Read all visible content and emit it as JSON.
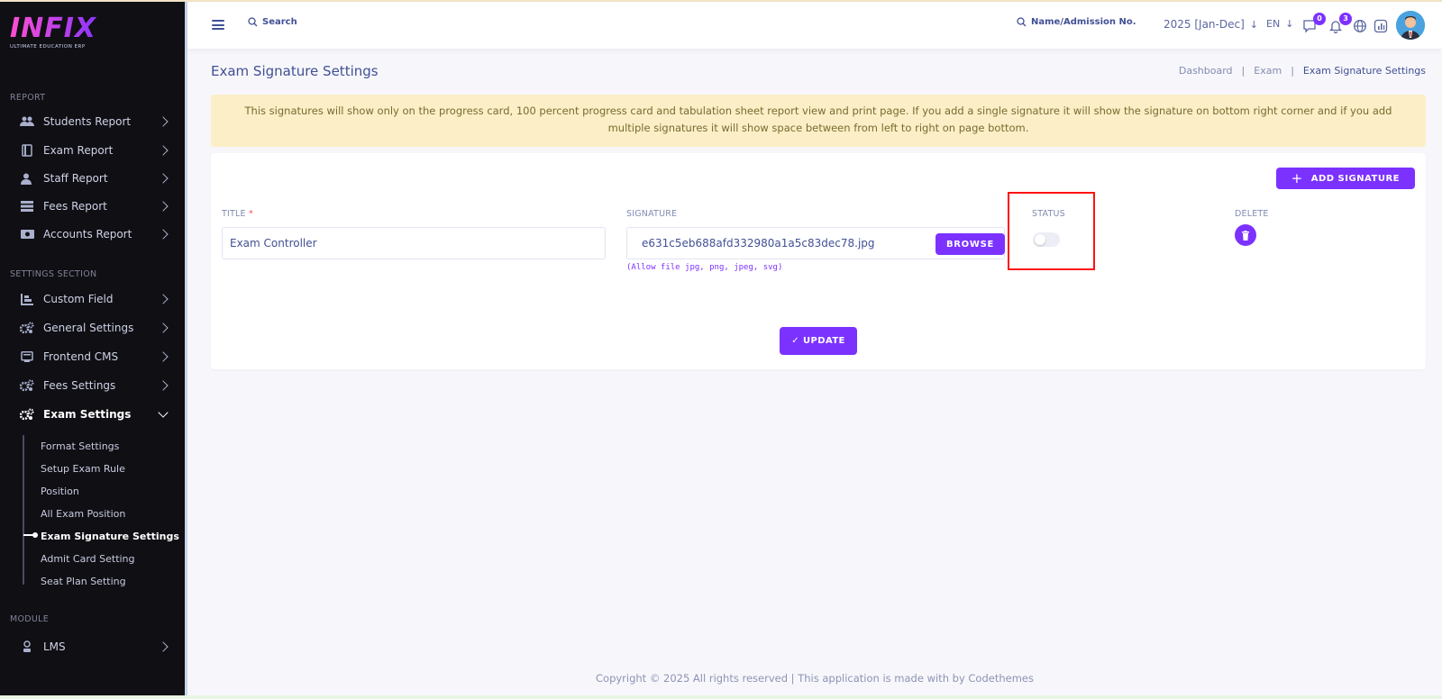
{
  "brand": {
    "logo": "INFIX",
    "tagline": "ULTIMATE EDUCATION ERP"
  },
  "sidebar": {
    "sections": {
      "report": "REPORT",
      "settings": "SETTINGS SECTION",
      "module": "MODULE"
    },
    "report_items": [
      {
        "label": "Students Report",
        "icon": "students-icon"
      },
      {
        "label": "Exam Report",
        "icon": "exam-report-icon"
      },
      {
        "label": "Staff Report",
        "icon": "staff-icon"
      },
      {
        "label": "Fees Report",
        "icon": "fees-report-icon"
      },
      {
        "label": "Accounts Report",
        "icon": "money-icon"
      }
    ],
    "settings_items": [
      {
        "label": "Custom Field",
        "icon": "custom-field-icon"
      },
      {
        "label": "General Settings",
        "icon": "gears-icon"
      },
      {
        "label": "Frontend CMS",
        "icon": "cms-icon"
      },
      {
        "label": "Fees Settings",
        "icon": "gears-icon"
      },
      {
        "label": "Exam Settings",
        "icon": "gears-icon"
      }
    ],
    "exam_settings_sub": [
      "Format Settings",
      "Setup Exam Rule",
      "Position",
      "All Exam Position",
      "Exam Signature Settings",
      "Admit Card Setting",
      "Seat Plan Setting"
    ],
    "module_items": [
      {
        "label": "LMS",
        "icon": "lms-icon"
      }
    ]
  },
  "header": {
    "search_placeholder": "Search",
    "student_search_placeholder": "Name/Admission No.",
    "session": "2025 [Jan-Dec]",
    "language": "EN",
    "messages_count": "0",
    "notifications_count": "3"
  },
  "page": {
    "title": "Exam Signature Settings",
    "breadcrumb": [
      "Dashboard",
      "Exam",
      "Exam Signature Settings"
    ],
    "separator": "|",
    "alert": "This signatures will show only on the progress card, 100 percent progress card and tabulation sheet report view and print page. If you add a single signature it will show the signature on bottom right corner and if you add multiple signatures it will show space between from left to right on page bottom.",
    "add_button": "ADD SIGNATURE",
    "columns": {
      "title": "TITLE",
      "required_mark": "*",
      "signature": "SIGNATURE",
      "status": "STATUS",
      "delete": "DELETE"
    },
    "row": {
      "title_value": "Exam Controller",
      "file_name": "e631c5eb688afd332980a1a5c83dec78.jpg",
      "browse_label": "BROWSE",
      "file_hint": "(Allow file jpg, png, jpeg, svg)",
      "status_on": false
    },
    "update_button": "UPDATE"
  },
  "footer": {
    "text": "Copyright © 2025 All rights reserved | This application is made with by Codethemes"
  },
  "colors": {
    "accent": "#7c32ff",
    "sidebar_bg": "#0f0f14",
    "alert_bg": "#fcefc7",
    "highlight_box": "#ff1212"
  }
}
